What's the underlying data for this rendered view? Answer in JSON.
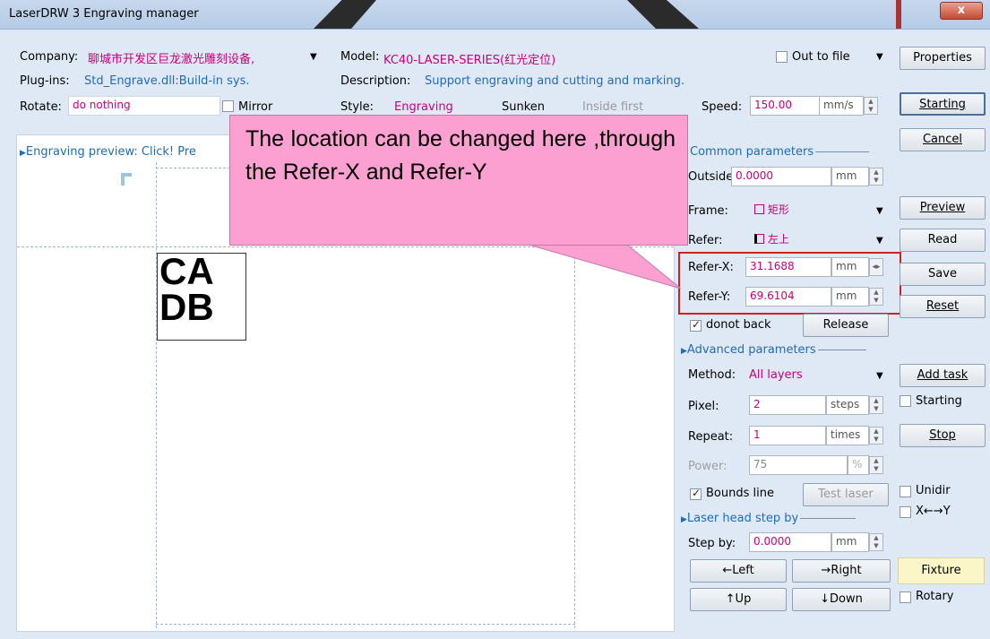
{
  "window": {
    "title": "LaserDRW 3 Engraving manager",
    "close_label": "x"
  },
  "top": {
    "company_label": "Company:",
    "company_value": "聊城市开发区巨龙激光雕刻设备,",
    "model_label": "Model:",
    "model_value": "KC40-LASER-SERIES(红光定位)",
    "out_to_file": "Out to file",
    "properties": "Properties",
    "plugins_label": "Plug-ins:",
    "plugins_value": "Std_Engrave.dll:Build-in sys.",
    "description_label": "Description:",
    "description_value": "Support engraving and cutting and marking.",
    "rotate_label": "Rotate:",
    "rotate_value": "do nothing",
    "mirror_label": "Mirror",
    "style_label": "Style:",
    "style_value": "Engraving",
    "sunken_label": "Sunken",
    "inside_first": "Inside first",
    "speed_label": "Speed:",
    "speed_value": "150.00",
    "speed_unit": "mm/s",
    "starting_btn": "Starting",
    "cancel_btn": "Cancel"
  },
  "preview": {
    "header": "Engraving preview: Click! Pre",
    "artwork_text_line1": "CA",
    "artwork_text_line2": "DB"
  },
  "callout": {
    "text": "The location can be changed here ,through the Refer-X and Refer-Y"
  },
  "common": {
    "header": "Common parameters",
    "outside_label": "Outside:",
    "outside_value": "0.0000",
    "outside_unit": "mm",
    "frame_label": "Frame:",
    "frame_value": "矩形",
    "refer_label": "Refer:",
    "refer_value": "左上",
    "refer_x_label": "Refer-X:",
    "refer_x_value": "31.1688",
    "refer_x_unit": "mm",
    "refer_y_label": "Refer-Y:",
    "refer_y_value": "69.6104",
    "refer_y_unit": "mm",
    "donot_back": "donot back",
    "release_btn": "Release"
  },
  "right_buttons": {
    "preview": "Preview",
    "read": "Read",
    "save": "Save",
    "reset": "Reset",
    "add_task": "Add task",
    "starting_chk": "Starting",
    "stop": "Stop",
    "unidir": "Unidir",
    "xy": "X←→Y",
    "fixture": "Fixture",
    "rotary": "Rotary"
  },
  "advanced": {
    "header": "Advanced parameters",
    "method_label": "Method:",
    "method_value": "All layers",
    "pixel_label": "Pixel:",
    "pixel_value": "2",
    "pixel_unit": "steps",
    "repeat_label": "Repeat:",
    "repeat_value": "1",
    "repeat_unit": "times",
    "power_label": "Power:",
    "power_value": "75",
    "power_unit": "%",
    "bounds_line": "Bounds line",
    "test_laser": "Test laser"
  },
  "laser_head": {
    "header": "Laser head step by",
    "step_label": "Step by:",
    "step_value": "0.0000",
    "step_unit": "mm",
    "left": "←Left",
    "right": "→Right",
    "up": "↑Up",
    "down": "↓Down"
  }
}
